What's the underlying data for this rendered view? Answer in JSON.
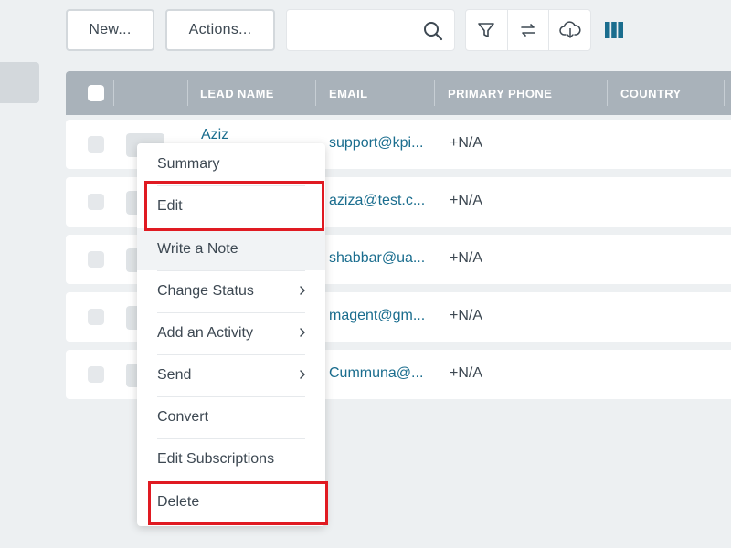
{
  "toolbar": {
    "new_label": "New...",
    "actions_label": "Actions...",
    "search_placeholder": "",
    "icons": [
      "search-icon",
      "filter-icon",
      "sync-icon",
      "download-icon",
      "columns-icon"
    ]
  },
  "table": {
    "headers": [
      "LEAD NAME",
      "EMAIL",
      "PRIMARY PHONE",
      "COUNTRY"
    ],
    "rows": [
      {
        "name": "Aziz",
        "email": "support@kpi...",
        "phone": "+N/A"
      },
      {
        "name": "",
        "email": "aziza@test.c...",
        "phone": "+N/A"
      },
      {
        "name": "",
        "email": "shabbar@ua...",
        "phone": "+N/A"
      },
      {
        "name": "",
        "email": "magent@gm...",
        "phone": "+N/A"
      },
      {
        "name": "",
        "email": "Cummuna@...",
        "phone": "+N/A"
      }
    ]
  },
  "context_menu": {
    "items": [
      {
        "label": "Summary"
      },
      {
        "label": "Edit"
      },
      {
        "label": "Write a Note"
      },
      {
        "label": "Change Status"
      },
      {
        "label": "Add an Activity"
      },
      {
        "label": "Send"
      },
      {
        "label": "Convert"
      },
      {
        "label": "Edit Subscriptions"
      },
      {
        "label": "Delete"
      }
    ]
  },
  "colors": {
    "accent": "#1a6d8e",
    "header_bg": "#a9b2ba",
    "highlight": "#e01a22",
    "page_bg": "#edf0f2"
  }
}
